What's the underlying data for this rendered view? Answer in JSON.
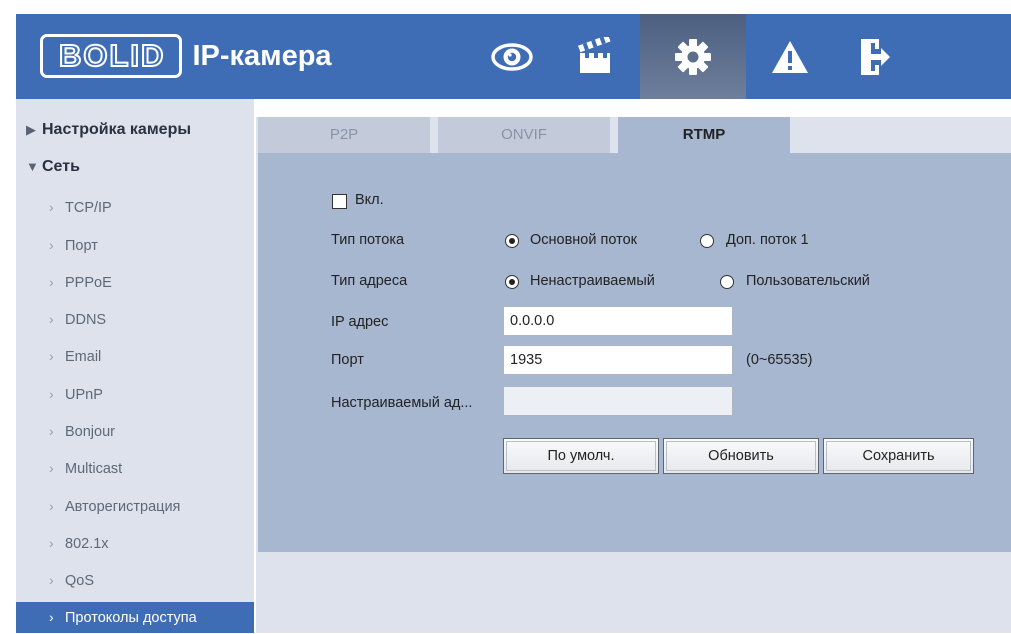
{
  "header": {
    "logo": "BOLID",
    "title": "IP-камера",
    "nav": [
      {
        "name": "live-view",
        "icon": "eye-icon"
      },
      {
        "name": "playback",
        "icon": "clapperboard-icon"
      },
      {
        "name": "settings",
        "icon": "gear-icon",
        "active": true
      },
      {
        "name": "alarm",
        "icon": "warning-icon"
      },
      {
        "name": "logout",
        "icon": "exit-door-icon"
      }
    ],
    "colors": {
      "bar": "#3f6db5",
      "active": "#5d6d8c"
    }
  },
  "sidebar": {
    "groups": [
      {
        "label": "Настройка камеры",
        "expanded": false
      },
      {
        "label": "Сеть",
        "expanded": true
      }
    ],
    "items": [
      {
        "label": "TCP/IP"
      },
      {
        "label": "Порт"
      },
      {
        "label": "PPPoE"
      },
      {
        "label": "DDNS"
      },
      {
        "label": "Email"
      },
      {
        "label": "UPnP"
      },
      {
        "label": "Bonjour"
      },
      {
        "label": "Multicast"
      },
      {
        "label": "Авторегистрация"
      },
      {
        "label": "802.1x"
      },
      {
        "label": "QoS"
      },
      {
        "label": "Протоколы доступа",
        "active": true
      }
    ]
  },
  "tabs": [
    {
      "label": "P2P"
    },
    {
      "label": "ONVIF"
    },
    {
      "label": "RTMP",
      "active": true
    }
  ],
  "form": {
    "enable_label": "Вкл.",
    "enable_checked": false,
    "stream_type": {
      "label": "Тип потока",
      "options": [
        "Основной поток",
        "Доп. поток 1"
      ],
      "selected": "Основной поток"
    },
    "address_type": {
      "label": "Тип адреса",
      "options": [
        "Ненастраиваемый",
        "Пользовательский"
      ],
      "selected": "Ненастраиваемый"
    },
    "ip": {
      "label": "IP адрес",
      "value": "0.0.0.0"
    },
    "port": {
      "label": "Порт",
      "value": "1935",
      "range": "(0~65535)"
    },
    "custom_address": {
      "label": "Настраиваемый ад...",
      "value": ""
    }
  },
  "buttons": {
    "default": "По умолч.",
    "refresh": "Обновить",
    "save": "Сохранить"
  }
}
